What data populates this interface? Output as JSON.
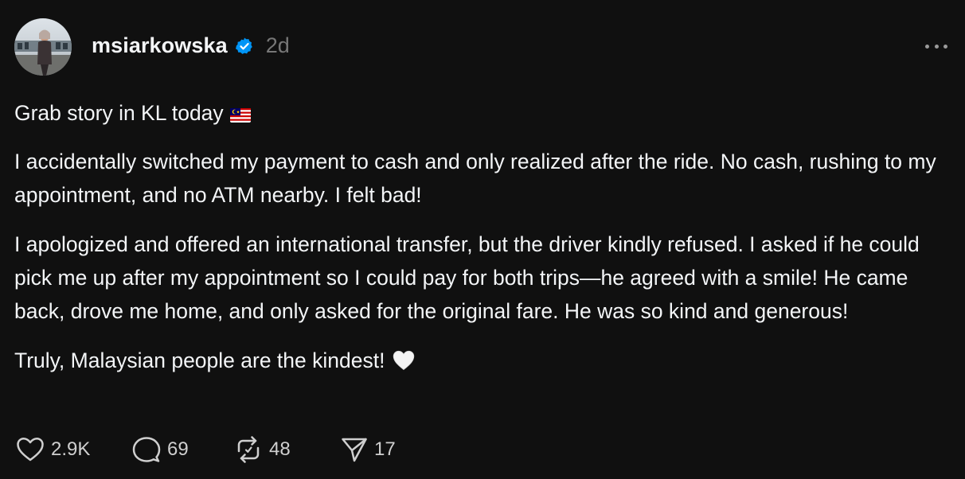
{
  "author": {
    "username": "msiarkowska",
    "verified": true,
    "timestamp": "2d",
    "avatar_icon": "profile-photo"
  },
  "post": {
    "paragraphs": [
      "Grab story in KL today",
      "I accidentally switched my payment to cash and only realized after the ride. No cash, rushing to my appointment, and no ATM nearby. I felt bad!",
      "I apologized and offered an international transfer, but the driver kindly refused. I asked if he could pick me up after my appointment so I could pay for both trips—he agreed with a smile! He came back, drove me home, and only asked for the original fare. He was so kind and generous!",
      "Truly, Malaysian people are the kindest!"
    ],
    "emojis": {
      "first_paragraph": "malaysia-flag",
      "last_paragraph": "white-heart"
    }
  },
  "actions": {
    "likes": "2.9K",
    "replies": "69",
    "reposts": "48",
    "shares": "17"
  },
  "colors": {
    "background": "#101010",
    "text": "#f3f5f7",
    "muted": "#777777",
    "verified_blue": "#0095f6"
  }
}
